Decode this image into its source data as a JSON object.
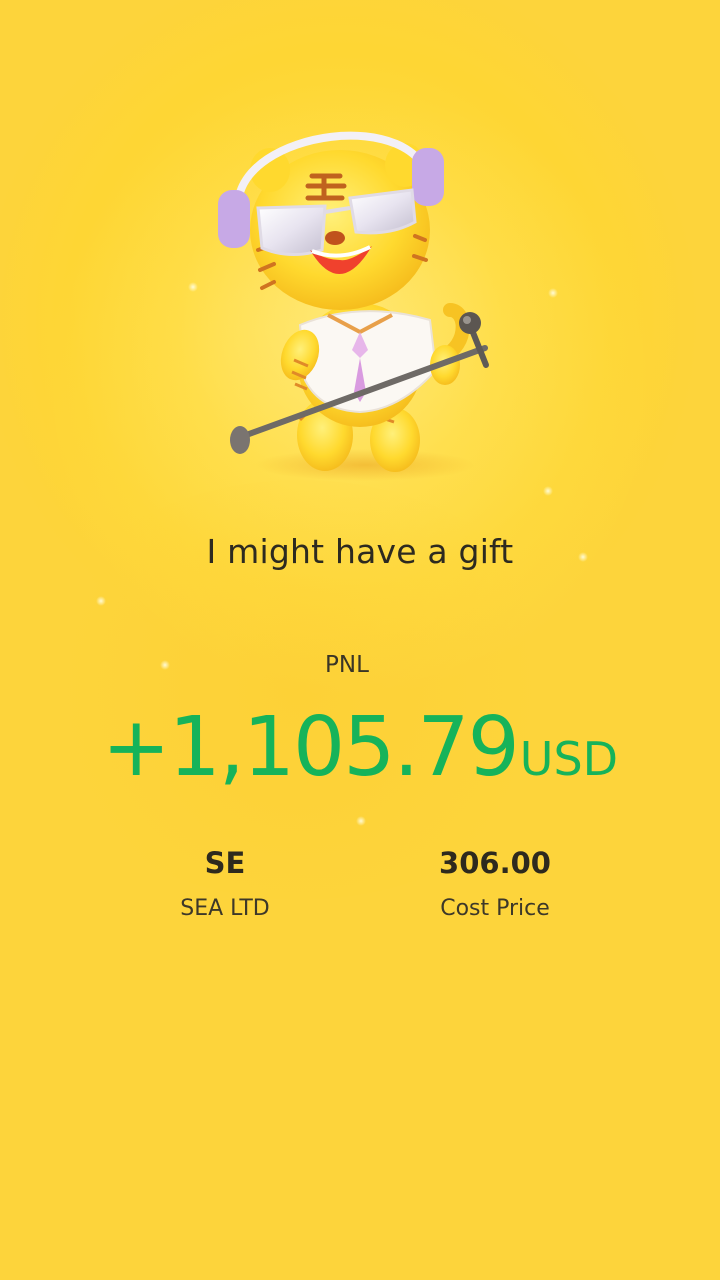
{
  "headline": "I might have a gift",
  "pnl": {
    "label": "PNL",
    "value": "+1,105.79",
    "currency": "USD",
    "color": "#16b35a"
  },
  "stock": {
    "ticker": "SE",
    "name": "SEA LTD"
  },
  "cost": {
    "value": "306.00",
    "label": "Cost Price"
  },
  "illustration": "tiger-mascot-singing"
}
